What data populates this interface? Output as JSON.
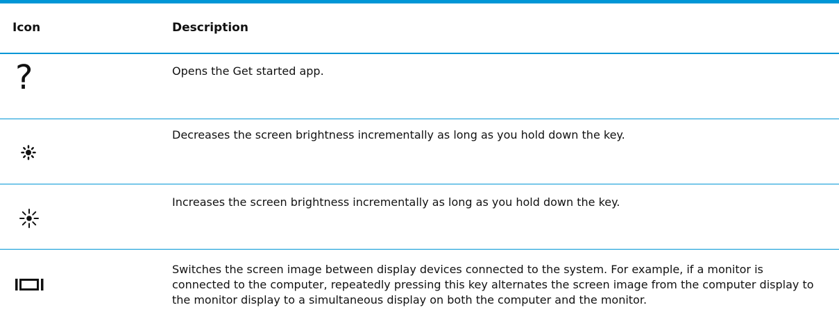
{
  "table": {
    "headers": {
      "icon": "Icon",
      "description": "Description"
    },
    "rows": [
      {
        "icon": "question-mark-icon",
        "icon_text": "?",
        "description": "Opens the Get started app."
      },
      {
        "icon": "brightness-down-icon",
        "description": "Decreases the screen brightness incrementally as long as you hold down the key."
      },
      {
        "icon": "brightness-up-icon",
        "description": "Increases the screen brightness incrementally as long as you hold down the key."
      },
      {
        "icon": "display-switch-icon",
        "description": "Switches the screen image between display devices connected to the system. For example, if a monitor is connected to the computer, repeatedly pressing this key alternates the screen image from the computer display to the monitor display to a simultaneous display on both the computer and the monitor."
      }
    ]
  },
  "colors": {
    "accent": "#0096d6",
    "text": "#111111",
    "background": "#ffffff"
  }
}
